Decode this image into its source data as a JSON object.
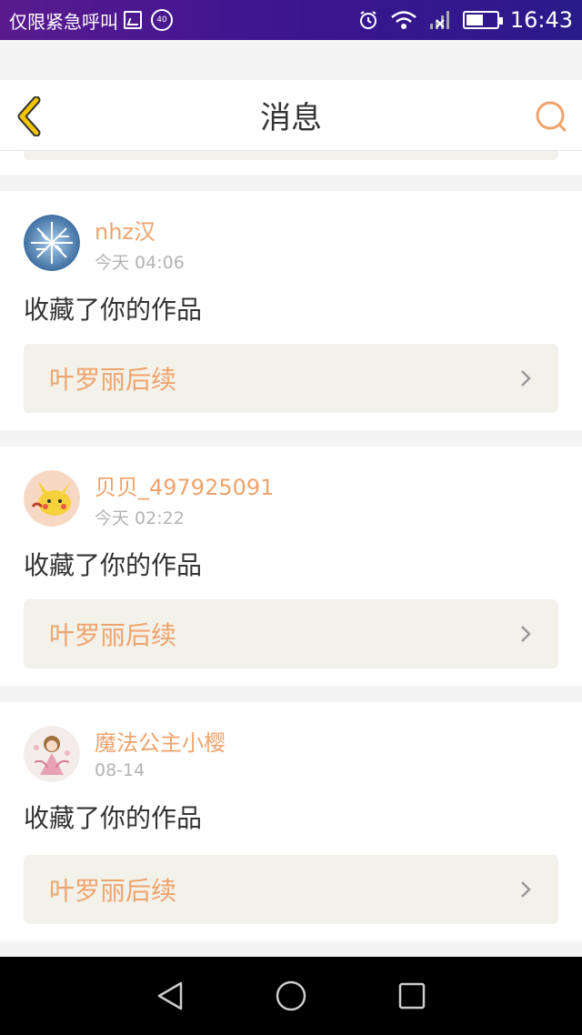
{
  "status_bar": {
    "carrier_text": "仅限紧急呼叫",
    "badge": "40",
    "time": "16:43"
  },
  "header": {
    "title": "消息"
  },
  "colors": {
    "accent": "#f0a36c",
    "back_icon": "#f2c500",
    "card_bg": "#f3f2ea"
  },
  "notifications": [
    {
      "username": "nhz汉",
      "time": "今天 04:06",
      "action": "收藏了你的作品",
      "work_title": "叶罗丽后续",
      "avatar": "snowflake-avatar"
    },
    {
      "username": "贝贝_497925091",
      "time": "今天 02:22",
      "action": "收藏了你的作品",
      "work_title": "叶罗丽后续",
      "avatar": "pikachu-avatar"
    },
    {
      "username": "魔法公主小樱",
      "time": "08-14",
      "action": "收藏了你的作品",
      "work_title": "叶罗丽后续",
      "avatar": "sakura-avatar"
    }
  ],
  "navbar": {
    "icons": [
      "back-triangle-icon",
      "home-circle-icon",
      "recent-square-icon"
    ]
  }
}
